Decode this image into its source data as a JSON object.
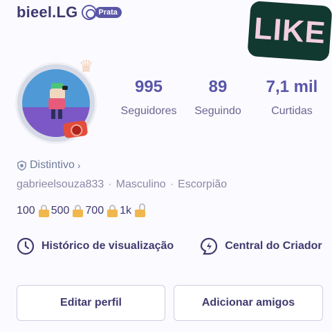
{
  "profile": {
    "username": "bieel.LG",
    "badge_label": "Prata",
    "handle": "gabrieelsouza833",
    "gender": "Masculino",
    "sign": "Escorpião",
    "info_separator": "·"
  },
  "sticker": {
    "text": "LIKE"
  },
  "stats": [
    {
      "value": "995",
      "label": "Seguidores"
    },
    {
      "value": "89",
      "label": "Seguindo"
    },
    {
      "value": "7,1 mil",
      "label": "Curtidas"
    }
  ],
  "distintivo": {
    "label": "Distintivo",
    "chevron": "›"
  },
  "milestones": [
    "100",
    "500",
    "700",
    "1k"
  ],
  "actions": {
    "history": "Histórico de visualização",
    "creator": "Central do Criador"
  },
  "buttons": {
    "edit": "Editar perfil",
    "add": "Adicionar amigos"
  },
  "colors": {
    "primary": "#5a56a8",
    "text": "#3f3a6e",
    "sticker_bg": "#12392f",
    "sticker_text": "#f2cfe0",
    "lock": "#f1b64c"
  },
  "icons": {
    "badge": "medal-icon",
    "distintivo": "shield-icon",
    "history": "clock-icon",
    "creator": "lightning-icon",
    "milestone": "lock-icon"
  }
}
